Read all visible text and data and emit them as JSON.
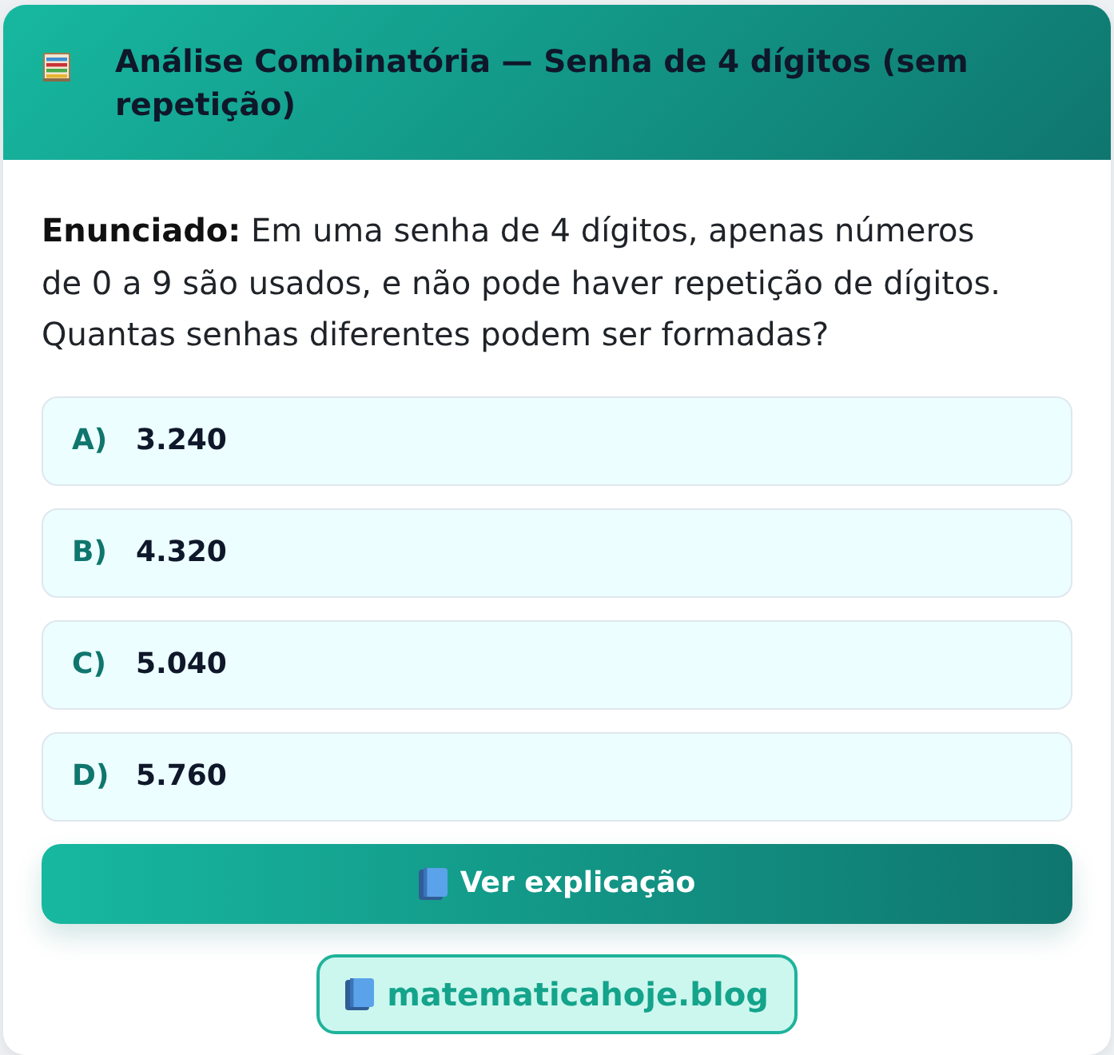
{
  "header": {
    "title": "Análise Combinatória — Senha de 4 dígitos (sem repetição)"
  },
  "question": {
    "text": "**Enunciado:** Em uma senha de 4 dígitos, apenas números de 0 a 9 são usados, e não pode haver repetição de dígitos. Quantas senhas diferentes podem ser formadas?"
  },
  "options": [
    {
      "letter": "A)",
      "value": "3.240"
    },
    {
      "letter": "B)",
      "value": "4.320"
    },
    {
      "letter": "C)",
      "value": "5.040"
    },
    {
      "letter": "D)",
      "value": "5.760"
    }
  ],
  "explain_button": {
    "label": "Ver explicação"
  },
  "site_link": {
    "label": "matematicahoje.blog"
  }
}
